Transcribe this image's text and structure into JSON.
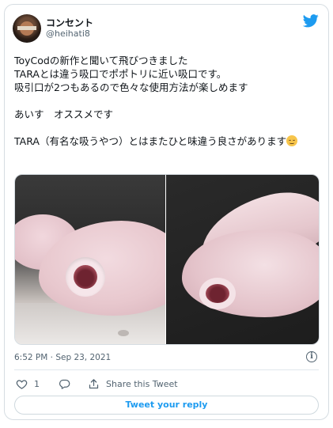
{
  "author": {
    "display_name": "コンセント",
    "handle": "@heihati8"
  },
  "tweet": {
    "paragraph1": "ToyCodの新作と聞いて飛びつきました\nTARAとは違う吸口でポポトリに近い吸口です。\n吸引口が2つもあるので色々な使用方法が楽しめます",
    "paragraph2": "あいす　オススメです",
    "paragraph3": "TARA（有名な吸うやつ）とはまたひと味違う良さがあります",
    "emoji": "relieved-face"
  },
  "meta": {
    "timestamp": "6:52 PM · Sep 23, 2021"
  },
  "actions": {
    "like_count": "1",
    "share_label": "Share this Tweet",
    "reply_button": "Tweet your reply"
  },
  "colors": {
    "accent": "#1d9bf0",
    "text": "#0f1419",
    "muted": "#536471",
    "border": "#d6dde2"
  },
  "icons": [
    "twitter-bird-icon",
    "info-icon",
    "heart-icon",
    "reply-bubble-icon",
    "share-icon"
  ]
}
